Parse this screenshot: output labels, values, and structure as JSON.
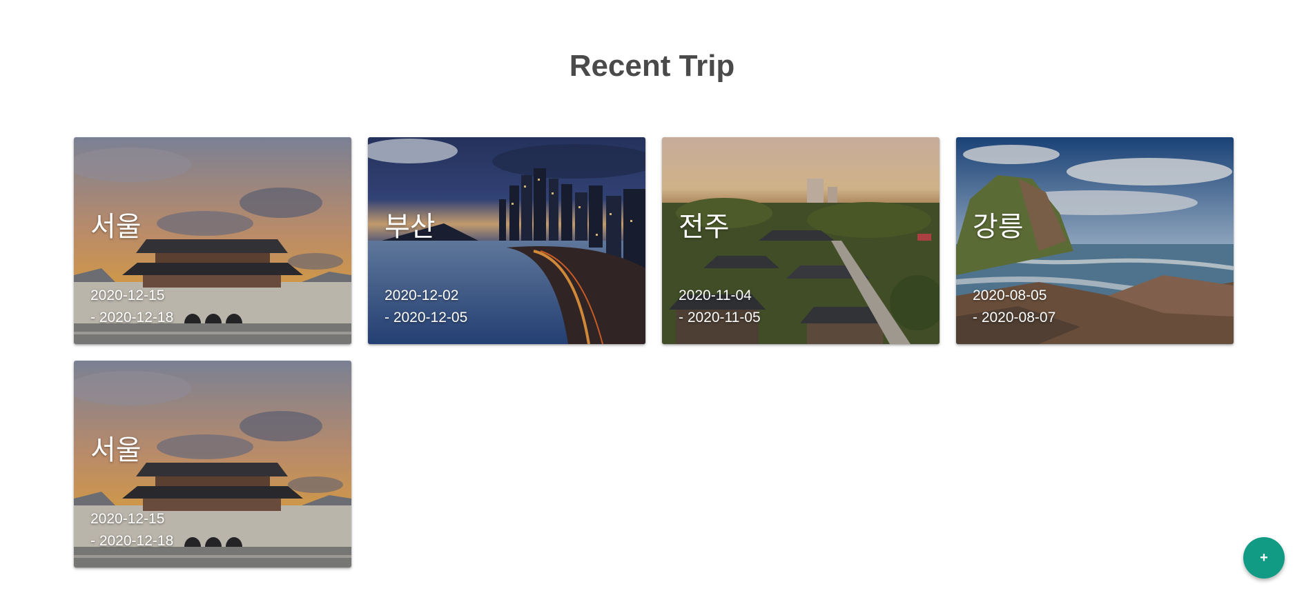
{
  "header": {
    "title": "Recent Trip"
  },
  "trips": [
    {
      "city": "서울",
      "start_date": "2020-12-15",
      "end_date": "- 2020-12-18",
      "scene": "palace-sunset"
    },
    {
      "city": "부산",
      "start_date": "2020-12-02",
      "end_date": "- 2020-12-05",
      "scene": "beach-city-night"
    },
    {
      "city": "전주",
      "start_date": "2020-11-04",
      "end_date": "- 2020-11-05",
      "scene": "hanok-village"
    },
    {
      "city": "강릉",
      "start_date": "2020-08-05",
      "end_date": "- 2020-08-07",
      "scene": "rocky-coast"
    },
    {
      "city": "서울",
      "start_date": "2020-12-15",
      "end_date": "- 2020-12-18",
      "scene": "palace-sunset"
    }
  ],
  "fab": {
    "label": "+",
    "icon": "plus-icon",
    "color": "#119b84"
  }
}
